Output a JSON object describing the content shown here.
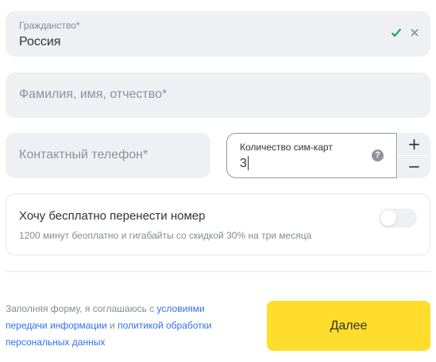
{
  "citizenship": {
    "label": "Гражданство*",
    "value": "Россия",
    "icons": [
      "check-icon",
      "clear-icon"
    ],
    "check_color": "#13a347"
  },
  "full_name": {
    "placeholder": "Фамилия, имя, отчество*"
  },
  "phone": {
    "placeholder": "Контактный телефон*"
  },
  "sim_count": {
    "label": "Количество сим-карт",
    "value": "3",
    "help_symbol": "?",
    "plus_symbol": "+",
    "minus_symbol": "−"
  },
  "number_transfer": {
    "title": "Хочу бесплатно перенести номер",
    "subtitle": "1200 минут беоплатно и гигабайты со скидкой 30% на три месяца",
    "toggle_on": false
  },
  "consent": {
    "text_before": "Заполняя форму, я соглашаюсь с ",
    "link_terms": "условиями передачи информации",
    "text_between": " и ",
    "link_policy": "политикой обработки персональных данных",
    "link_color": "#336fee"
  },
  "submit": {
    "label": "Далее",
    "color": "#ffdd2d"
  }
}
